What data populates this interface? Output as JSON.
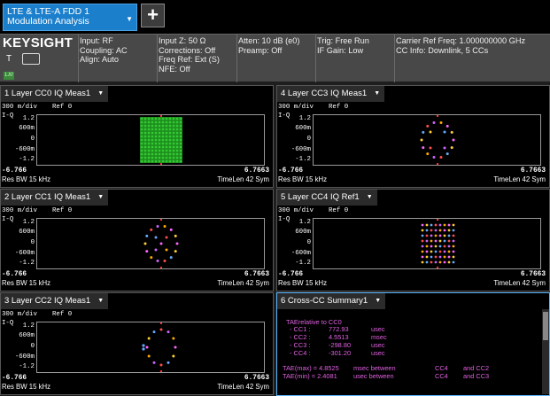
{
  "tab": {
    "line1": "LTE & LTE-A FDD 1",
    "line2": "Modulation Analysis"
  },
  "add_label": "+",
  "brand": {
    "name": "KEYSIGHT",
    "t_label": "T",
    "lxi": "LXI"
  },
  "info": {
    "col1": [
      "Input: RF",
      "Coupling: AC",
      "Align: Auto"
    ],
    "col2": [
      "Input Z: 50 Ω",
      "Corrections: Off",
      "Freq Ref: Ext (S)",
      "NFE: Off"
    ],
    "col3": [
      "Atten: 10 dB (e0)",
      "Preamp: Off"
    ],
    "col4": [
      "Trig: Free Run",
      "IF Gain: Low"
    ],
    "col5": [
      "Carrier Ref Freq: 1.000000000 GHz",
      "CC Info: Downlink, 5 CCs"
    ]
  },
  "windows": [
    {
      "title": "1 Layer CC0 IQ Meas1",
      "scale": "300 m/div",
      "ref": "Ref 0",
      "yname": "I-Q",
      "ticks": [
        "1.2",
        "600m",
        "0",
        "-600m",
        "-1.2"
      ],
      "xmin": "-6.766",
      "xmax": "6.7663",
      "rbw": "Res BW 15 kHz",
      "timelen": "TimeLen 42  Sym",
      "constellation": "64qam"
    },
    {
      "title": "4 Layer CC3 IQ Meas1",
      "scale": "300 m/div",
      "ref": "Ref 0",
      "yname": "I-Q",
      "ticks": [
        "1.2",
        "600m",
        "0",
        "-600m",
        "-1.2"
      ],
      "xmin": "-6.766",
      "xmax": "6.7663",
      "rbw": "Res BW 15 kHz",
      "timelen": "TimeLen 42  Sym",
      "constellation": "ring_qpsk"
    },
    {
      "title": "2 Layer CC1 IQ Meas1",
      "scale": "300 m/div",
      "ref": "Ref 0",
      "yname": "I-Q",
      "ticks": [
        "1.2",
        "600m",
        "0",
        "-600m",
        "-1.2"
      ],
      "xmin": "-6.766",
      "xmax": "6.7663",
      "rbw": "Res BW 15 kHz",
      "timelen": "TimeLen 42  Sym",
      "constellation": "ring_16"
    },
    {
      "title": "5 Layer CC4 IQ Ref1",
      "scale": "300 m/div",
      "ref": "Ref 0",
      "yname": "I-Q",
      "ticks": [
        "1.2",
        "600m",
        "0",
        "-600m",
        "-1.2"
      ],
      "xmin": "-6.766",
      "xmax": "6.7663",
      "rbw": "Res BW 15 kHz",
      "timelen": "TimeLen 42  Sym",
      "constellation": "grid_colored"
    },
    {
      "title": "3 Layer CC2 IQ Meas1",
      "scale": "300 m/div",
      "ref": "Ref 0",
      "yname": "I-Q",
      "ticks": [
        "1.2",
        "600m",
        "0",
        "-600m",
        "-1.2"
      ],
      "xmin": "-6.766",
      "xmax": "6.7663",
      "rbw": "Res BW 15 kHz",
      "timelen": "TimeLen 42  Sym",
      "constellation": "ring_sparse"
    }
  ],
  "summary": {
    "title": "6 Cross-CC Summary1",
    "heading": "TAErelative   to  CC0",
    "rows": [
      {
        "cc": "- CC1 :",
        "value": "772.93",
        "unit": "usec"
      },
      {
        "cc": "- CC2 :",
        "value": "4.5513",
        "unit": "msec"
      },
      {
        "cc": "- CC3 :",
        "value": "-298.80",
        "unit": "usec"
      },
      {
        "cc": "- CC4 :",
        "value": "-301.20",
        "unit": "usec"
      }
    ],
    "max_line": {
      "label": "TAE(max) = 4.8525",
      "unit": "msec  between",
      "a": "CC4",
      "b": "and CC2"
    },
    "min_line": {
      "label": "TAE(min) = 2.4081",
      "unit": "usec  between",
      "a": "CC4",
      "b": "and CC3"
    }
  },
  "colors": {
    "accent": "#1b7fcc",
    "plot_green": "#33cc33",
    "summary_text": "#e060e0",
    "active_border": "#5cb8ff"
  }
}
